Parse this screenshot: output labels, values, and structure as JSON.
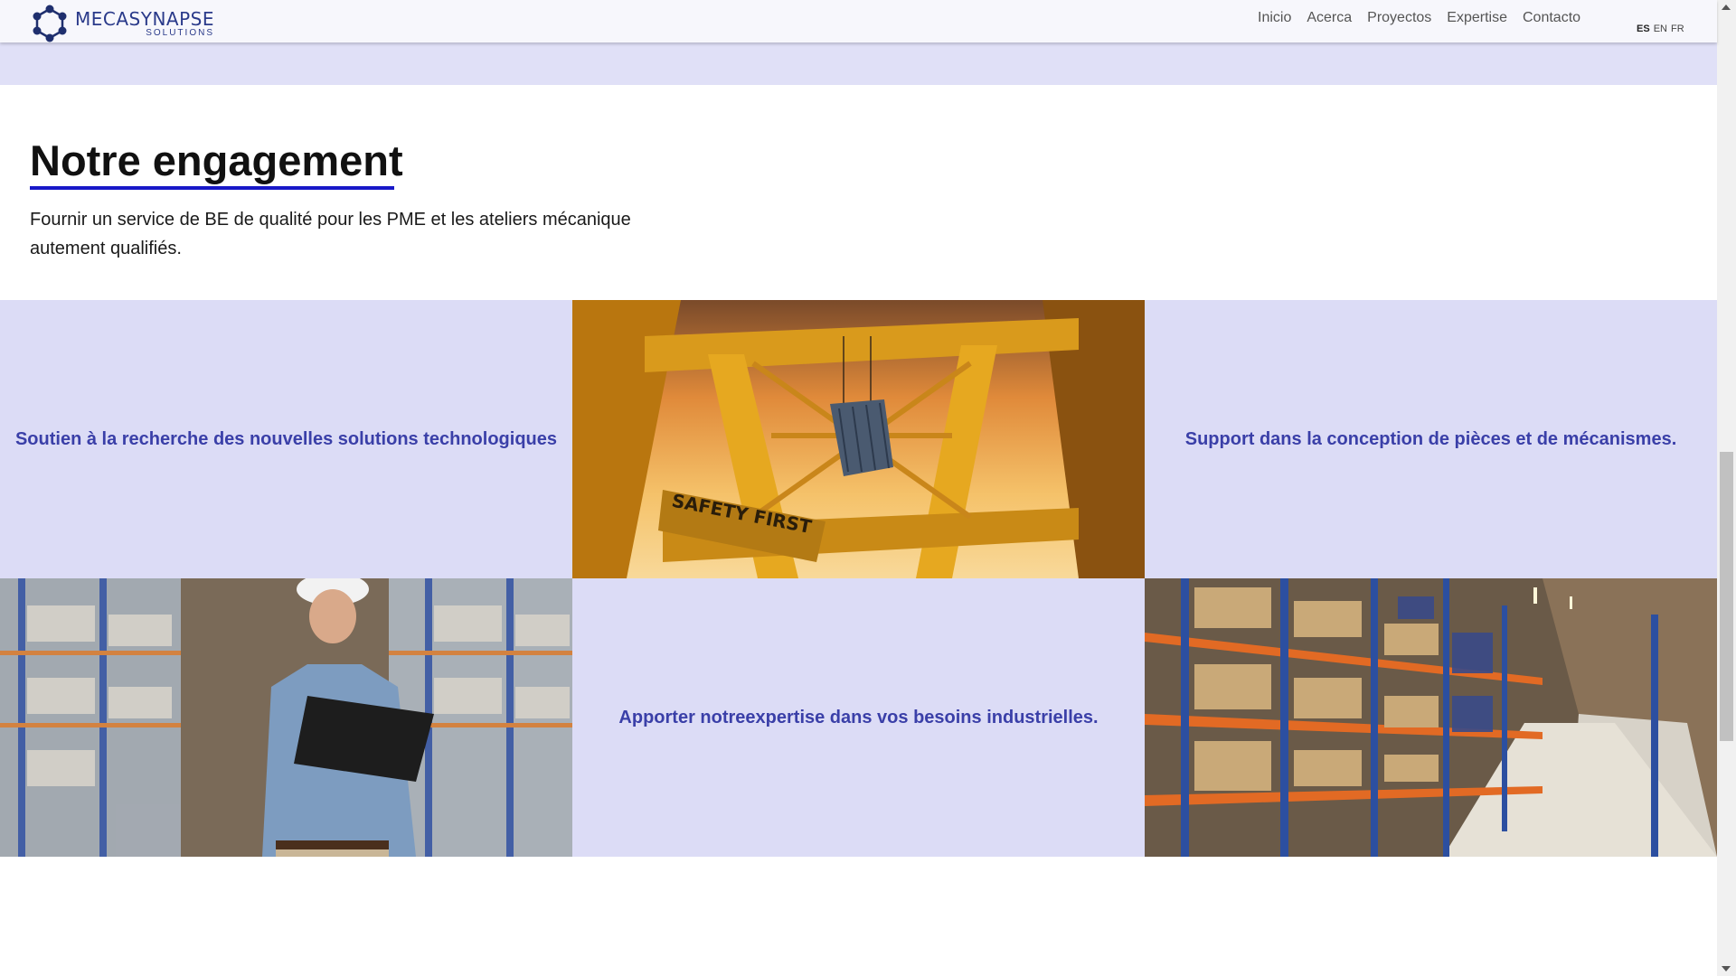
{
  "header": {
    "logo": {
      "name": "MECASYNAPSE",
      "sub": "SOLUTIONS"
    },
    "nav": [
      "Inicio",
      "Acerca",
      "Proyectos",
      "Expertise",
      "Contacto"
    ],
    "languages": [
      "ES",
      "EN",
      "FR"
    ],
    "active_language": "ES"
  },
  "section": {
    "title": "Notre engagement",
    "description": "Fournir un service de BE de qualité pour les PME et les ateliers mécanique autement qualifiés."
  },
  "grid": {
    "cell1_text": "Soutien à la recherche des nouvelles solutions technologiques",
    "cell2_image": "port-crane-image",
    "cell2_sign": "SAFETY FIRST",
    "cell3_text": "Support dans la conception de pièces et de mécanismes.",
    "cell4_image": "warehouse-worker-image",
    "cell5_text": "Apporter notreexpertise dans vos besoins industrielles.",
    "cell6_image": "warehouse-aisle-image"
  },
  "colors": {
    "accent": "#1818c8",
    "band": "#e0e0f7",
    "cell_bg": "#dcdcf6",
    "cell_text": "#3a3fa8"
  }
}
